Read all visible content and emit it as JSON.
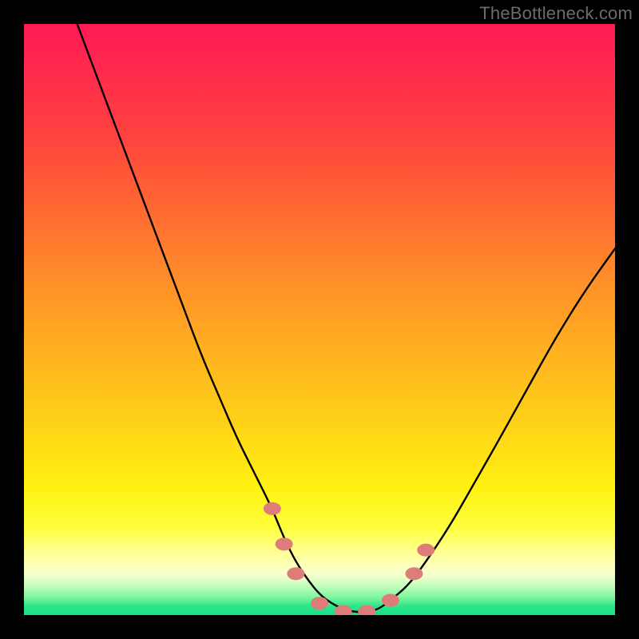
{
  "attribution": "TheBottleneck.com",
  "chart_data": {
    "type": "line",
    "title": "",
    "xlabel": "",
    "ylabel": "",
    "xlim": [
      0,
      100
    ],
    "ylim": [
      0,
      100
    ],
    "series": [
      {
        "name": "curve",
        "x": [
          9,
          12,
          15,
          18,
          21,
          24,
          27,
          30,
          33,
          36,
          39,
          42,
          44,
          46,
          48,
          50,
          52,
          54,
          56,
          58,
          60,
          62,
          65,
          68,
          72,
          76,
          80,
          85,
          90,
          95,
          100
        ],
        "y": [
          100,
          92,
          84,
          76,
          68,
          60,
          52,
          44,
          37,
          30,
          24,
          18,
          13,
          9,
          6,
          3.5,
          2,
          1,
          0.5,
          0.5,
          1,
          2.5,
          5,
          9,
          15,
          22,
          29,
          38,
          47,
          55,
          62
        ]
      }
    ],
    "markers": [
      {
        "x": 42,
        "y": 18
      },
      {
        "x": 44,
        "y": 12
      },
      {
        "x": 46,
        "y": 7
      },
      {
        "x": 50,
        "y": 2
      },
      {
        "x": 54,
        "y": 0.6
      },
      {
        "x": 58,
        "y": 0.6
      },
      {
        "x": 62,
        "y": 2.5
      },
      {
        "x": 66,
        "y": 7
      },
      {
        "x": 68,
        "y": 11
      }
    ],
    "background_gradient": {
      "top": "#ff1a54",
      "middle": "#ffd317",
      "bottom": "#17e08a"
    }
  }
}
